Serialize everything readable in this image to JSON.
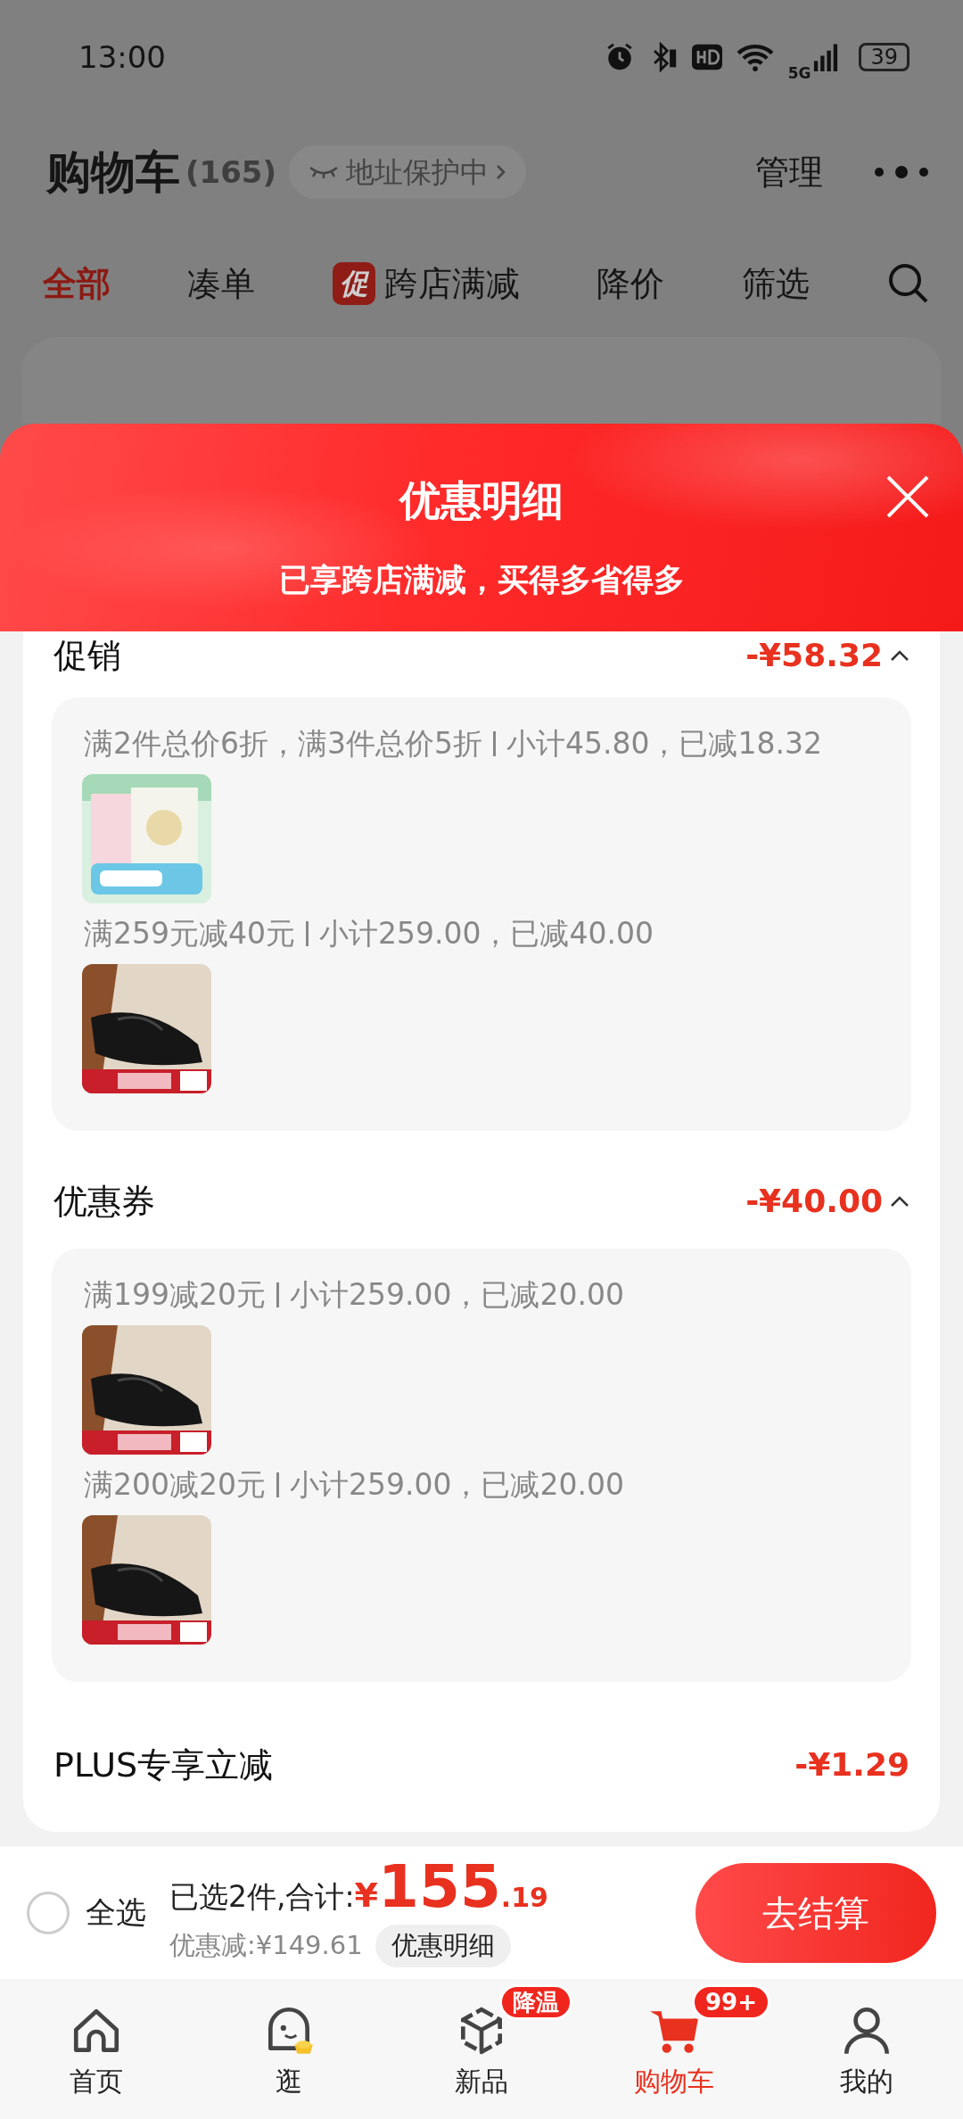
{
  "status_bar": {
    "time": "13:00",
    "network": "5G",
    "battery": "39"
  },
  "header": {
    "title": "购物车",
    "count": "(165)",
    "address_chip": "地址保护中",
    "manage": "管理"
  },
  "tabs": [
    {
      "label": "全部",
      "selected": true
    },
    {
      "label": "凑单",
      "selected": false
    },
    {
      "label": "跨店满减",
      "selected": false,
      "badge": "促"
    },
    {
      "label": "降价",
      "selected": false
    },
    {
      "label": "筛选",
      "selected": false
    }
  ],
  "sheet": {
    "title": "优惠明细",
    "subtitle": "已享跨店满减，买得多省得多",
    "sections": [
      {
        "name": "促销",
        "amount": "-¥58.32",
        "expanded": true,
        "groups": [
          {
            "rule": "满2件总价6折，满3件总价5折",
            "detail": "小计45.80，已减18.32"
          },
          {
            "rule": "满259元减40元",
            "detail": "小计259.00，已减40.00"
          }
        ]
      },
      {
        "name": "优惠券",
        "amount": "-¥40.00",
        "expanded": true,
        "groups": [
          {
            "rule": "满199减20元",
            "detail": "小计259.00，已减20.00"
          },
          {
            "rule": "满200减20元",
            "detail": "小计259.00，已减20.00"
          }
        ]
      },
      {
        "name": "PLUS专享立减",
        "amount": "-¥1.29"
      }
    ]
  },
  "bottom_bar": {
    "select_all": {
      "label": "全选",
      "checked": false
    },
    "summary": "已选2件,合计:",
    "currency": "¥",
    "total_integer": "155",
    "total_decimal": ".19",
    "discount": "优惠减:¥149.61",
    "detail_button": "优惠明细",
    "checkout": "去结算"
  },
  "nav": [
    {
      "label": "首页",
      "selected": false
    },
    {
      "label": "逛",
      "selected": false
    },
    {
      "label": "新品",
      "selected": false,
      "badge": "降温"
    },
    {
      "label": "购物车",
      "selected": true,
      "badge": "99+"
    },
    {
      "label": "我的",
      "selected": false
    }
  ]
}
